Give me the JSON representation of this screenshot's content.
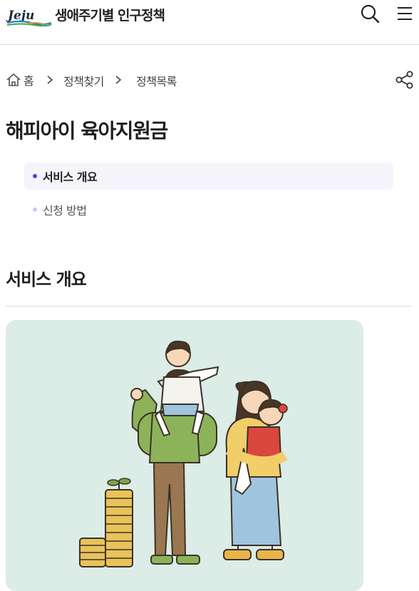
{
  "header": {
    "logo_text": "Jeju",
    "site_title": "생애주기별 인구정책",
    "search_icon": "search-icon",
    "menu_icon": "hamburger-menu-icon"
  },
  "breadcrumb": {
    "home": "홈",
    "items": [
      "정책찾기",
      "정책목록"
    ],
    "share_icon": "share-icon"
  },
  "page": {
    "title": "해피아이 육아지원금"
  },
  "toc": [
    {
      "label": "서비스 개요",
      "active": true
    },
    {
      "label": "신청 방법",
      "active": false
    }
  ],
  "section": {
    "title": "서비스 개요"
  },
  "colors": {
    "accent": "#5b3fd6",
    "accent_light": "#cfc5f1",
    "card_bg": "#dcece6"
  }
}
